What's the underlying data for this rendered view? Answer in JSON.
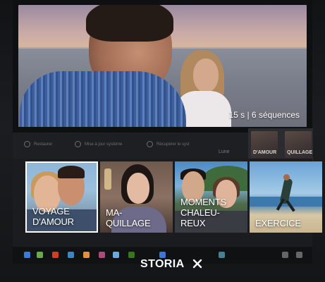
{
  "background": {
    "toolbar": {
      "restore_label": "Restaurer",
      "sync_label": "Mise à jour système",
      "recover_label": "Récupérer le syst"
    },
    "side_thumb_labels": [
      "D'AMOUR",
      "QUILLAGE"
    ],
    "extra_label": "Lune"
  },
  "hero": {
    "caption": "15 s | 6 séquences"
  },
  "stories": [
    {
      "lines": [
        "VOYAGE",
        "D'AMOUR"
      ],
      "selected": true
    },
    {
      "lines": [
        "MA-",
        "QUILLAGE"
      ],
      "selected": false
    },
    {
      "lines": [
        "MOMENTS",
        "CHALEU-",
        "REUX"
      ],
      "selected": false
    },
    {
      "lines": [
        "EXERCICE"
      ],
      "selected": false
    }
  ],
  "footer": {
    "title": "STORIA",
    "close_icon": "close-icon"
  },
  "colors": {
    "selected_border": "#ffffff",
    "background": "#0b0c0e"
  }
}
